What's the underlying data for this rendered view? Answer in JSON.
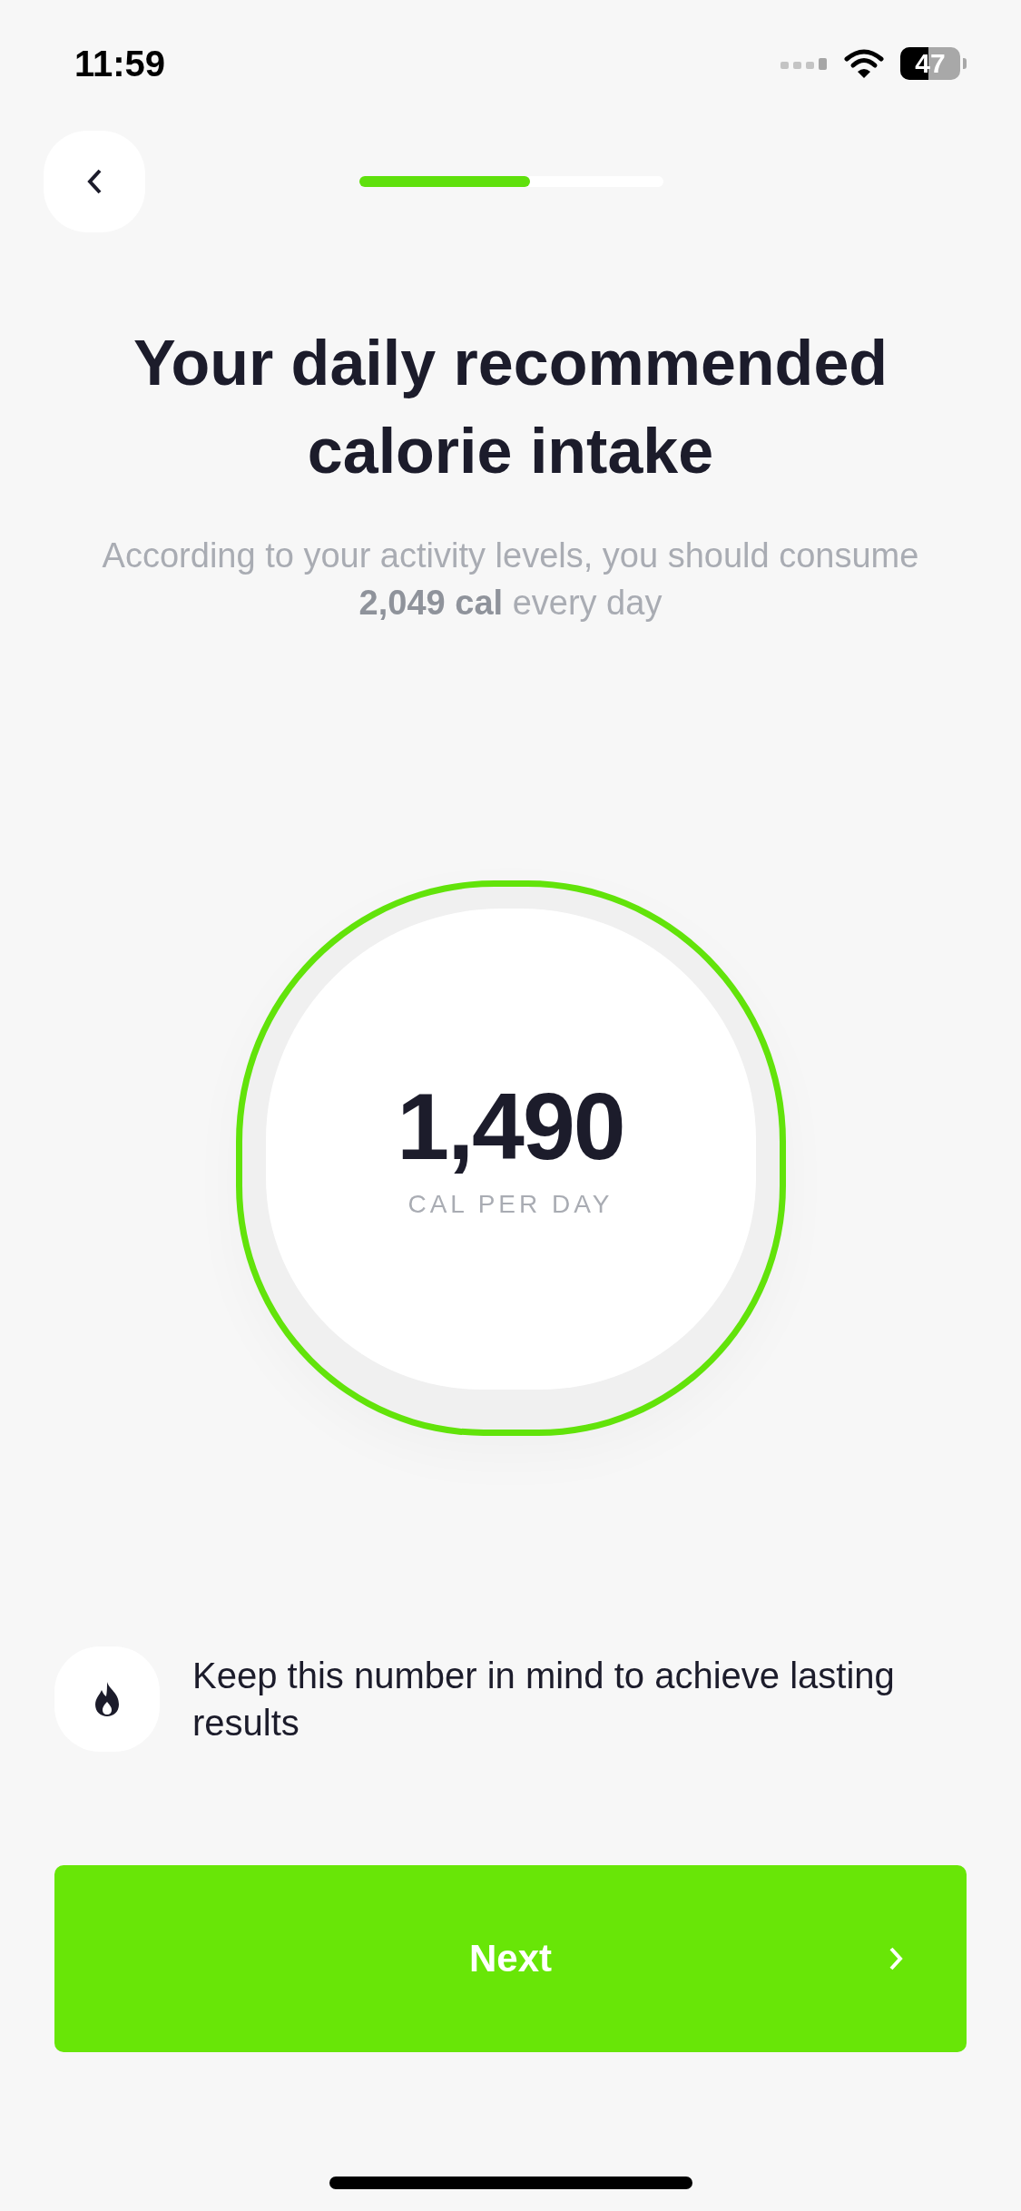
{
  "status_bar": {
    "time": "11:59",
    "battery": "47"
  },
  "progress": {
    "level": 0.56
  },
  "title": "Your daily recommended calorie intake",
  "subtitle": "According to your activity levels, you should consume **2,049 cal** every day",
  "calories": {
    "value": "1,490",
    "unit": "CAL PER DAY"
  },
  "tip": "Keep this number in mind to achieve lasting results",
  "next_button": {
    "label": "Next"
  }
}
